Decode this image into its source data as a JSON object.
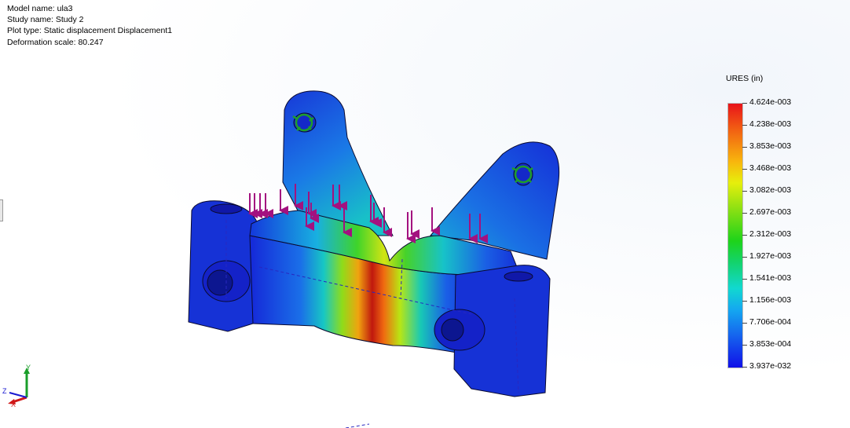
{
  "info": {
    "model_name": "Model name: ula3",
    "study_name": "Study name: Study 2",
    "plot_type": "Plot type: Static displacement Displacement1",
    "deformation_scale": "Deformation scale: 80.247"
  },
  "legend": {
    "title": "URES (in)",
    "ticks": [
      "4.624e-003",
      "4.238e-003",
      "3.853e-003",
      "3.468e-003",
      "3.082e-003",
      "2.697e-003",
      "2.312e-003",
      "1.927e-003",
      "1.541e-003",
      "1.156e-003",
      "7.706e-004",
      "3.853e-004",
      "3.937e-032"
    ]
  },
  "triad": {
    "x_label": "X",
    "y_label": "Y",
    "z_label": "Z"
  },
  "colors": {
    "max": "#e8131a",
    "min": "#1010e8",
    "load_arrow": "#a3117f",
    "fixture": "#1f9e2a"
  }
}
